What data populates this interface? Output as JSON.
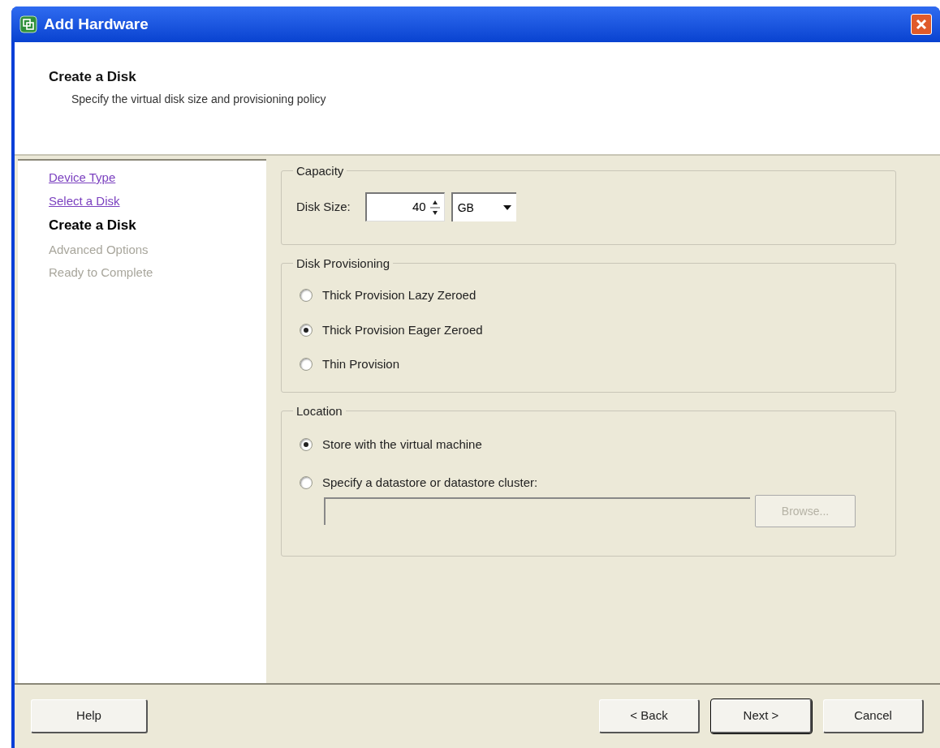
{
  "window": {
    "title": "Add Hardware"
  },
  "header": {
    "title": "Create a Disk",
    "subtitle": "Specify the virtual disk size and provisioning policy"
  },
  "steps": [
    {
      "label": "Device Type",
      "kind": "visited"
    },
    {
      "label": "Select a Disk",
      "kind": "visited"
    },
    {
      "label": "Create a Disk",
      "kind": "current"
    },
    {
      "label": "Advanced Options",
      "kind": "pending"
    },
    {
      "label": "Ready to Complete",
      "kind": "pending"
    }
  ],
  "capacity": {
    "legend": "Capacity",
    "label": "Disk Size:",
    "value": "40",
    "unit": "GB"
  },
  "provisioning": {
    "legend": "Disk Provisioning",
    "options": [
      {
        "label": "Thick Provision Lazy Zeroed",
        "selected": false
      },
      {
        "label": "Thick Provision Eager Zeroed",
        "selected": true
      },
      {
        "label": "Thin Provision",
        "selected": false
      }
    ]
  },
  "location": {
    "legend": "Location",
    "options": [
      {
        "label": "Store with the virtual machine",
        "selected": true
      },
      {
        "label": "Specify a datastore or datastore cluster:",
        "selected": false
      }
    ],
    "path_disabled": true,
    "browse": {
      "label": "Browse...",
      "disabled": true
    }
  },
  "buttons": [
    {
      "label": "Help",
      "kind": "help",
      "default": false
    },
    {
      "label": "< Back",
      "kind": "back",
      "default": false
    },
    {
      "label": "Next >",
      "kind": "next",
      "default": true
    },
    {
      "label": "Cancel",
      "kind": "cancel",
      "default": false
    }
  ]
}
